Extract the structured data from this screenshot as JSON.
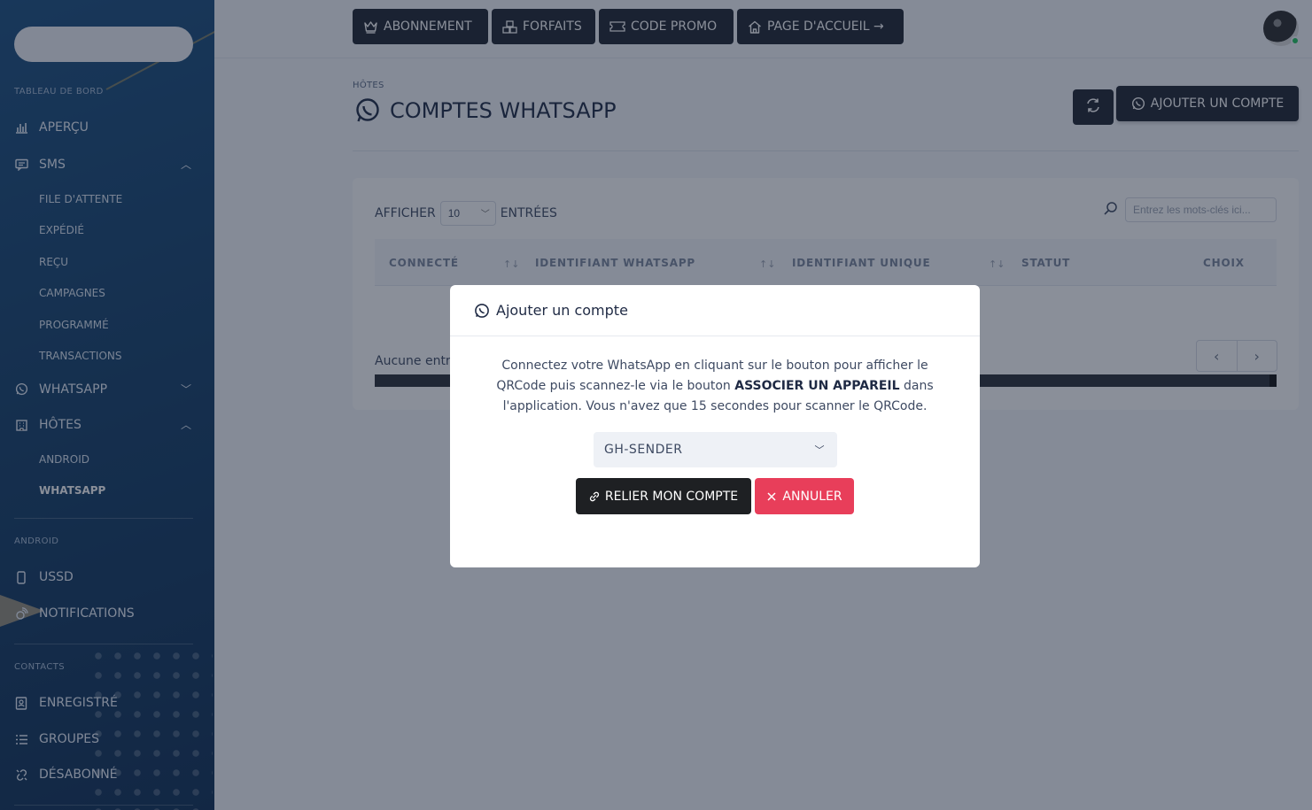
{
  "sidebar": {
    "sections": {
      "dashboard": "TABLEAU DE BORD",
      "android": "ANDROID",
      "contacts": "CONTACTS"
    },
    "items": {
      "overview": "APERÇU",
      "sms": "SMS",
      "whatsapp": "WHATSAPP",
      "hosts": "HÔTES",
      "ussd": "USSD",
      "notifications": "NOTIFICATIONS",
      "saved": "ENREGISTRÉ",
      "groups": "GROUPES",
      "unsubscribed": "DÉSABONNÉ"
    },
    "sms_sub": [
      "FILE D'ATTENTE",
      "EXPÉDIÉ",
      "REÇU",
      "CAMPAGNES",
      "PROGRAMMÉ",
      "TRANSACTIONS"
    ],
    "hosts_sub": [
      "ANDROID",
      "WHATSAPP"
    ]
  },
  "topbar": {
    "subscription": "ABONNEMENT",
    "packages": "FORFAITS",
    "promo": "CODE PROMO",
    "home": "PAGE D'ACCUEIL →"
  },
  "page": {
    "breadcrumb": "HÔTES",
    "title": "COMPTES WHATSAPP",
    "add_account": "AJOUTER UN COMPTE"
  },
  "table": {
    "show_label": "AFFICHER",
    "page_size": "10",
    "entries_label": "ENTRÉES",
    "search_placeholder": "Entrez les mots-clés ici...",
    "columns": [
      "CONNECTÉ",
      "IDENTIFIANT WHATSAPP",
      "IDENTIFIANT UNIQUE",
      "STATUT",
      "CHOIX"
    ],
    "empty_text": "Aucune entrée"
  },
  "modal": {
    "title": "Ajouter un compte",
    "text_before": "Connectez votre WhatsApp en cliquant sur le bouton pour afficher le QRCode puis scannez-le via le bouton ",
    "text_bold": "ASSOCIER UN APPAREIL",
    "text_after": " dans l'application. Vous n'avez que 15 secondes pour scanner le QRCode.",
    "selected_sender": "GH-SENDER",
    "link_button": "RELIER MON COMPTE",
    "cancel_button": "ANNULER"
  },
  "colors": {
    "sidebar": "#15406a",
    "dark_button": "#1e2430",
    "danger": "#e83e5a",
    "online": "#22c55e"
  }
}
